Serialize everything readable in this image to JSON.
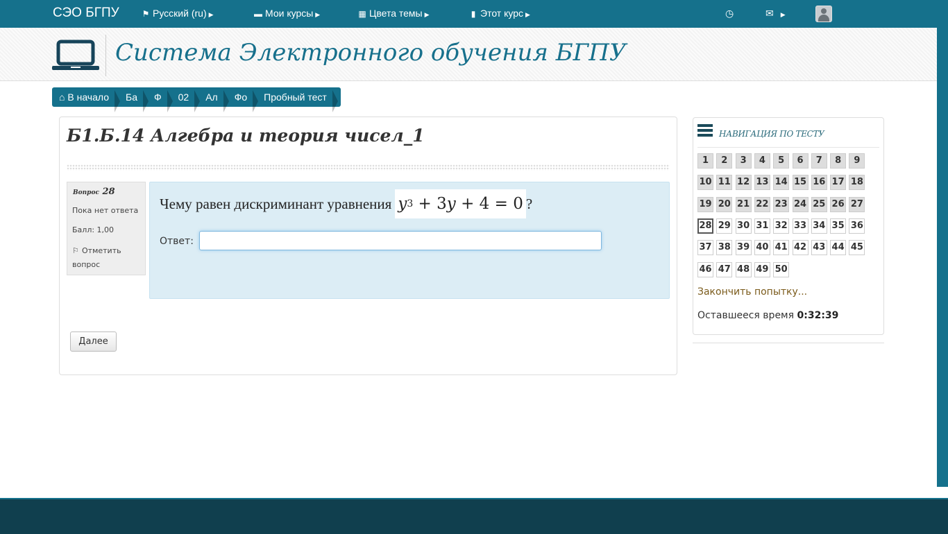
{
  "topbar": {
    "brand": "СЭО БГПУ",
    "menu": [
      {
        "icon": "flag-icon",
        "label": "Русский (ru)"
      },
      {
        "icon": "briefcase-icon",
        "label": "Мои курсы"
      },
      {
        "icon": "grid-icon",
        "label": "Цвета темы"
      },
      {
        "icon": "book-icon",
        "label": "Этот курс"
      }
    ],
    "icons": [
      "clock-icon",
      "envelope-icon",
      "user-avatar"
    ]
  },
  "banner": {
    "site_name": "Система Электронного обучения БГПУ"
  },
  "breadcrumb": [
    "В начало",
    "Ба",
    "Ф",
    "02",
    "Ал",
    "Фо",
    "Пробный тест"
  ],
  "course": {
    "title": "Б1.Б.14 Алгебра и теория чисел_1"
  },
  "question": {
    "label": "Вопрос",
    "number": "28",
    "state": "Пока нет ответа",
    "grade": "Балл: 1,00",
    "flag_label": "Отметить вопрос",
    "text": "Чему равен дискриминант уравнения",
    "formula": {
      "a": "y",
      "exp": "3",
      "b": "+ 3",
      "c": "y",
      "d": "+ 4 = 0"
    },
    "text_end": "?",
    "answer_label": "Ответ:",
    "answer_value": ""
  },
  "buttons": {
    "next": "Далее"
  },
  "nav": {
    "title": "НАВИГАЦИЯ ПО ТЕСТУ",
    "current": 28,
    "total": 50,
    "finish_link": "Закончить попытку...",
    "time_label": "Оставшееся время",
    "time_value": "0:32:39"
  },
  "colors": {
    "brand": "#15718c",
    "footer": "#103f4e",
    "question_bg": "#dcedf5"
  }
}
